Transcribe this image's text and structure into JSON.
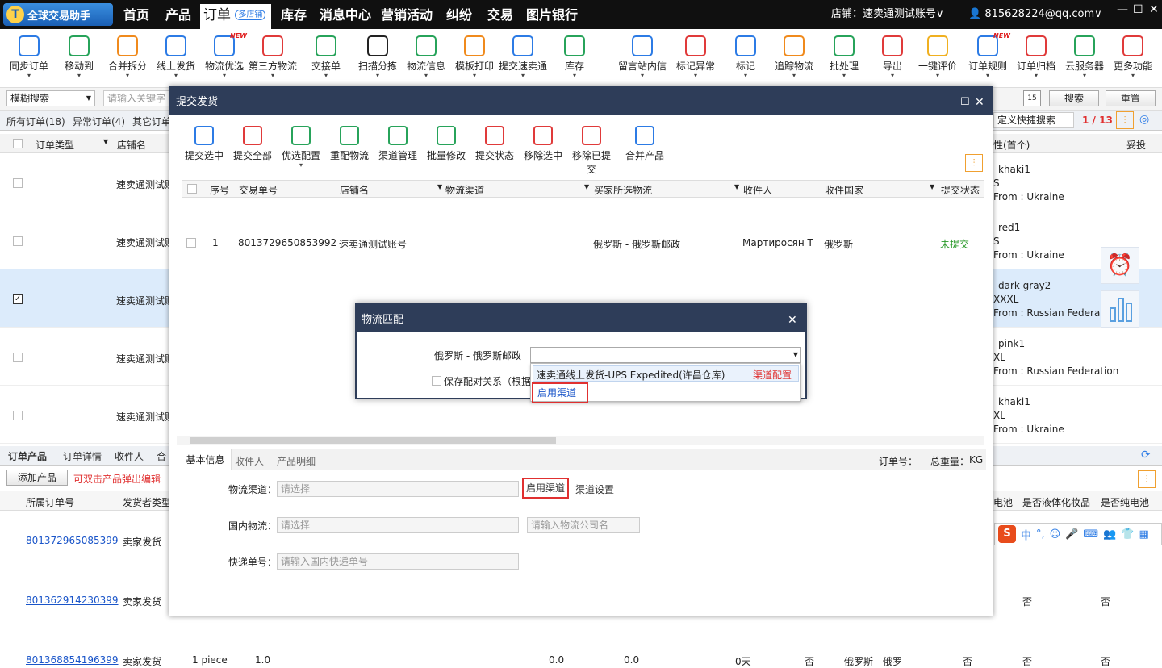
{
  "app": {
    "title": "全球交易助手"
  },
  "nav": [
    "首页",
    "产品",
    "订单",
    "库存",
    "消息中心",
    "营销活动",
    "纠纷",
    "交易",
    "图片银行"
  ],
  "nav_order_tag": "多店铺",
  "shop_label": "店铺：速卖通测试账号∨",
  "user": "815628224@qq.com∨",
  "window": {
    "min": "—",
    "max": "☐",
    "close": "✕"
  },
  "toolbar": [
    {
      "label": "同步订单",
      "color": "#2c7be5"
    },
    {
      "label": "移动到",
      "color": "#27a35a"
    },
    {
      "label": "合并拆分",
      "color": "#f08a1c"
    },
    {
      "label": "线上发货",
      "color": "#2c7be5"
    },
    {
      "label": "物流优选",
      "color": "#2c7be5",
      "new": "NEW"
    },
    {
      "label": "第三方物流",
      "color": "#e03a3a"
    },
    {
      "label": "交接单",
      "color": "#27a35a"
    },
    {
      "label": "扫描分拣",
      "color": "#222"
    },
    {
      "label": "物流信息",
      "color": "#27a35a"
    },
    {
      "label": "模板打印",
      "color": "#f08a1c"
    },
    {
      "label": "提交速卖通",
      "color": "#2c7be5"
    },
    {
      "label": "库存",
      "color": "#27a35a"
    },
    {
      "label": "留言站内信",
      "color": "#2c7be5"
    },
    {
      "label": "标记异常",
      "color": "#e03a3a"
    },
    {
      "label": "标记",
      "color": "#2c7be5"
    },
    {
      "label": "追踪物流",
      "color": "#f08a1c"
    },
    {
      "label": "批处理",
      "color": "#27a35a"
    },
    {
      "label": "导出",
      "color": "#e03a3a"
    },
    {
      "label": "一键评价",
      "color": "#f0b020"
    },
    {
      "label": "订单规则",
      "color": "#2c7be5",
      "new": "NEW"
    },
    {
      "label": "订单归档",
      "color": "#e03a3a"
    },
    {
      "label": "云服务器",
      "color": "#27a35a"
    },
    {
      "label": "更多功能",
      "color": "#e03a3a"
    }
  ],
  "filter": {
    "mode": "模糊搜索",
    "placeholder": "请输入关键字",
    "search": "搜索",
    "reset": "重置",
    "quick": "定义快捷搜索",
    "page": "1 / 13"
  },
  "tabs": [
    "所有订单(18)",
    "异常订单(4)",
    "其它订单"
  ],
  "columns": {
    "type": "订单类型",
    "shop": "店铺名",
    "attr": "性(首个)",
    "ship": "妥投"
  },
  "rows": [
    {
      "shop": "速卖通测试账",
      "l1": "khaki1",
      "l2": "S",
      "l3": "From : Ukraine"
    },
    {
      "shop": "速卖通测试账",
      "l1": "red1",
      "l2": "S",
      "l3": "From : Ukraine"
    },
    {
      "shop": "速卖通测试账",
      "l1": "dark gray2",
      "l2": "XXXL",
      "l3": "From : Russian Federation"
    },
    {
      "shop": "速卖通测试账",
      "l1": "pink1",
      "l2": "XL",
      "l3": "From : Russian Federation"
    },
    {
      "shop": "速卖通测试账",
      "l1": "khaki1",
      "l2": "XL",
      "l3": "From : Ukraine"
    }
  ],
  "dialog": {
    "title": "提交发货",
    "tools": [
      "提交选中",
      "提交全部",
      "优选配置",
      "重配物流",
      "渠道管理",
      "批量修改",
      "提交状态",
      "移除选中",
      "移除已提交",
      "合并产品"
    ],
    "cols": [
      "序号",
      "交易单号",
      "店铺名",
      "物流渠道",
      "买家所选物流",
      "收件人",
      "收件国家",
      "提交状态"
    ],
    "row": {
      "no": "1",
      "id": "8013729650853992",
      "shop": "速卖通测试账号",
      "buyer": "俄罗斯 - 俄罗斯邮政",
      "recv": "Мартиросян Т",
      "country": "俄罗斯",
      "status": "未提交"
    },
    "lowtabs": [
      "基本信息",
      "收件人",
      "产品明细"
    ],
    "order_no": "订单号：",
    "weight": "总重量：",
    "kg": "KG",
    "f_channel": "物流渠道：",
    "f_channel_ph": "请选择",
    "enable": "启用渠道",
    "setting": "渠道设置",
    "f_domestic": "国内物流：",
    "f_domestic_ph": "请选择",
    "f_company_ph": "请输入物流公司名",
    "f_track": "快递单号：",
    "f_track_ph": "请输入国内快递单号"
  },
  "match": {
    "title": "物流匹配",
    "label": "俄罗斯 - 俄罗斯邮政",
    "save": "保存配对关系（根据",
    "option": "速卖通线上发货-UPS Expedited(许昌仓库)",
    "config": "渠道配置",
    "enable": "启用渠道"
  },
  "bottom": {
    "tabs": [
      "订单产品",
      "订单详情",
      "收件人",
      "合"
    ],
    "add": "添加产品",
    "hint": "可双击产品弹出编辑",
    "cols": {
      "order": "所属订单号",
      "shipper": "发货者类型"
    },
    "rcols": [
      "电池",
      "是否液体化妆品",
      "是否纯电池"
    ],
    "rows": [
      {
        "id": "801372965085399",
        "type": "卖家发货"
      },
      {
        "id": "801362914230399",
        "type": "卖家发货",
        "n1": "否",
        "n2": "否"
      },
      {
        "id": "801368854196399",
        "type": "卖家发货",
        "qty": "1 piece",
        "w": "1.0",
        "a": "0.0",
        "b": "0.0",
        "d": "0天",
        "e": "否",
        "c": "俄罗斯 - 俄罗",
        "n0": "否",
        "n1": "否",
        "n2": "否"
      }
    ]
  },
  "ime": {
    "lang": "中",
    "dot": "°,"
  }
}
